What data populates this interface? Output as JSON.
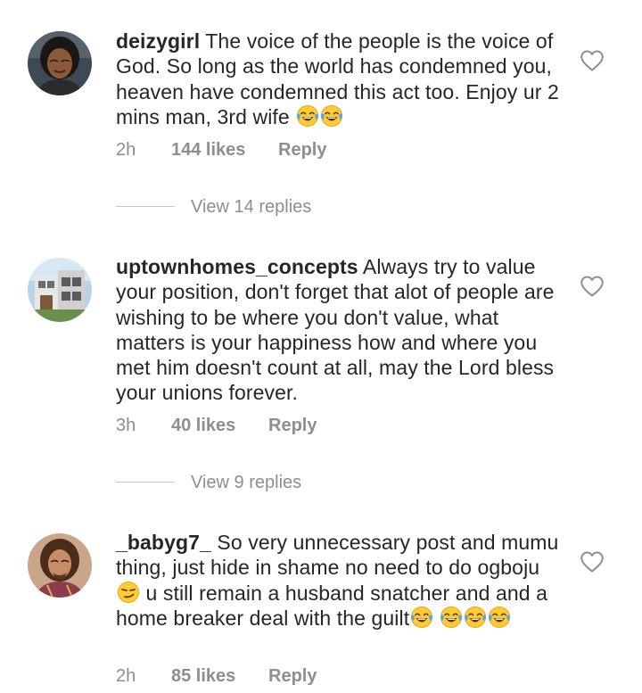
{
  "comments": [
    {
      "username": "deizygirl",
      "text": "The voice of the people is the voice of God. So long as the world has condemned you, heaven have condemned this act too. Enjoy ur 2 mins man, 3rd wife",
      "emoji_after": [
        "joy-emoji",
        "joy-emoji"
      ],
      "time": "2h",
      "likes": "144 likes",
      "reply_label": "Reply",
      "view_replies": "View 14 replies",
      "avatar_icon": "avatar-woman-icon"
    },
    {
      "username": "uptownhomes_concepts",
      "text": "Always try to value your position, don't forget that alot of people are wishing to be where you don't value,  what matters is your happiness how and where you met him doesn't count at all, may the Lord bless your unions forever.",
      "time": "3h",
      "likes": "40 likes",
      "reply_label": "Reply",
      "view_replies": "View 9 replies",
      "avatar_icon": "avatar-building-icon"
    },
    {
      "username": "_babyg7_",
      "text_part1": "So very unnecessary post and mumu thing, just hide in shame no need to do ogboju",
      "text_part2": " u still remain a husband snatcher and and a home breaker deal with the guilt",
      "emoji_mid": "smirk-emoji",
      "emoji_after": [
        "joy-emoji",
        "joy-emoji",
        "joy-emoji",
        "joy-emoji"
      ],
      "time": "2h",
      "likes": "85 likes",
      "reply_label": "Reply",
      "avatar_icon": "avatar-man-icon"
    }
  ],
  "colors": {
    "text": "#262626",
    "secondary": "#8e8e8e",
    "divider": "#c7c7c7",
    "heart_outline": "#8e8e8e"
  },
  "icons": {
    "like": "heart-outline-icon"
  }
}
